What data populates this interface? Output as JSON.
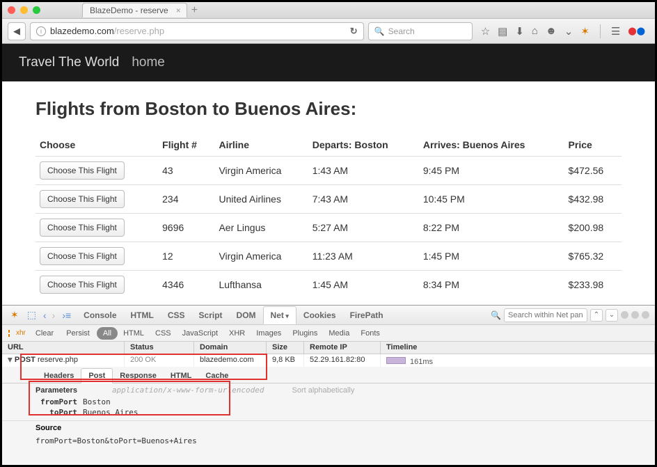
{
  "titlebar": {
    "tab_title": "BlazeDemo - reserve"
  },
  "toolbar": {
    "url_host": "blazedemo.com",
    "url_path": "/reserve.php",
    "search_placeholder": "Search"
  },
  "nav": {
    "brand": "Travel The World",
    "home": "home"
  },
  "page": {
    "heading": "Flights from Boston to Buenos Aires:",
    "choose_label": "Choose This Flight",
    "columns": [
      "Choose",
      "Flight #",
      "Airline",
      "Departs: Boston",
      "Arrives: Buenos Aires",
      "Price"
    ],
    "rows": [
      {
        "flight": "43",
        "airline": "Virgin America",
        "departs": "1:43 AM",
        "arrives": "9:45 PM",
        "price": "$472.56"
      },
      {
        "flight": "234",
        "airline": "United Airlines",
        "departs": "7:43 AM",
        "arrives": "10:45 PM",
        "price": "$432.98"
      },
      {
        "flight": "9696",
        "airline": "Aer Lingus",
        "departs": "5:27 AM",
        "arrives": "8:22 PM",
        "price": "$200.98"
      },
      {
        "flight": "12",
        "airline": "Virgin America",
        "departs": "11:23 AM",
        "arrives": "1:45 PM",
        "price": "$765.32"
      },
      {
        "flight": "4346",
        "airline": "Lufthansa",
        "departs": "1:45 AM",
        "arrives": "8:34 PM",
        "price": "$233.98"
      }
    ]
  },
  "devtools": {
    "tabs": [
      "Console",
      "HTML",
      "CSS",
      "Script",
      "DOM",
      "Net",
      "Cookies",
      "FirePath"
    ],
    "active_tab": "Net",
    "search_placeholder": "Search within Net pan",
    "subtabs": {
      "clear": "Clear",
      "persist": "Persist",
      "filters": [
        "All",
        "HTML",
        "CSS",
        "JavaScript",
        "XHR",
        "Images",
        "Plugins",
        "Media",
        "Fonts"
      ],
      "active_filter": "All"
    },
    "grid_headers": [
      "URL",
      "Status",
      "Domain",
      "Size",
      "Remote IP",
      "Timeline"
    ],
    "row": {
      "method": "POST",
      "file": "reserve.php",
      "status": "200 OK",
      "domain": "blazedemo.com",
      "size": "9,8 KB",
      "ip": "52.29.161.82:80",
      "time": "161ms"
    },
    "detail_tabs": [
      "Headers",
      "Post",
      "Response",
      "HTML",
      "Cache"
    ],
    "active_detail": "Post",
    "params_label": "Parameters",
    "mime": "application/x-www-form-urlencoded",
    "sort_label": "Sort alphabetically",
    "params": [
      {
        "key": "fromPort",
        "val": "Boston"
      },
      {
        "key": "toPort",
        "val": "Buenos Aires"
      }
    ],
    "source_label": "Source",
    "source_val": "fromPort=Boston&toPort=Buenos+Aires"
  }
}
